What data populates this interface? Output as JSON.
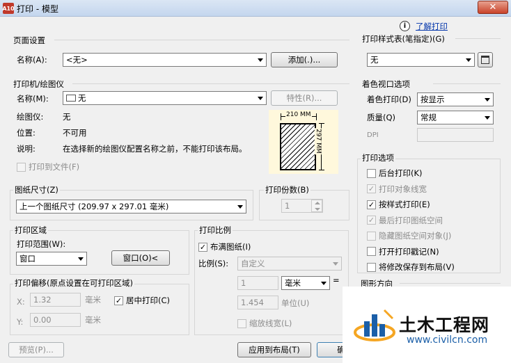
{
  "window": {
    "app_icon": "A10",
    "title": "打印 - 模型",
    "close": "✕",
    "help_link": "了解打印",
    "info_icon": "i"
  },
  "page_setup": {
    "group": "页面设置",
    "name_label": "名称(A):",
    "name_value": "<无>",
    "add_button": "添加(.)..."
  },
  "printer": {
    "group": "打印机/绘图仪",
    "name_label": "名称(M):",
    "name_value": "无",
    "properties_button": "特性(R)...",
    "plotter_label": "绘图仪:",
    "plotter_value": "无",
    "location_label": "位置:",
    "location_value": "不可用",
    "description_label": "说明:",
    "description_value": "在选择新的绘图仪配置名称之前，不能打印该布局。",
    "print_to_file": "打印到文件(F)",
    "preview_width": "210 MM",
    "preview_height": "297 MM"
  },
  "paper_size": {
    "group": "图纸尺寸(Z)",
    "value": "上一个图纸尺寸  (209.97 x 297.01 毫米)"
  },
  "copies": {
    "group": "打印份数(B)",
    "value": "1"
  },
  "plot_area": {
    "group": "打印区域",
    "what_label": "打印范围(W):",
    "what_value": "窗口",
    "window_button": "窗口(O)<"
  },
  "plot_offset": {
    "group": "打印偏移(原点设置在可打印区域)",
    "x_label": "X:",
    "x_value": "1.32",
    "x_unit": "毫米",
    "y_label": "Y:",
    "y_value": "0.00",
    "y_unit": "毫米",
    "center": "居中打印(C)"
  },
  "plot_scale": {
    "group": "打印比例",
    "fit": "布满图纸(I)",
    "scale_label": "比例(S):",
    "scale_value": "自定义",
    "value1": "1",
    "unit1": "毫米",
    "equals": "=",
    "value2": "1.454",
    "unit2": "单位(U)",
    "lineweights": "缩放线宽(L)"
  },
  "style_table": {
    "group": "打印样式表(笔指定)(G)",
    "value": "无"
  },
  "shaded": {
    "group": "着色视口选项",
    "shade_label": "着色打印(D)",
    "shade_value": "按显示",
    "quality_label": "质量(Q)",
    "quality_value": "常规",
    "dpi_label": "DPI"
  },
  "options": {
    "group": "打印选项",
    "items": [
      {
        "label": "后台打印(K)",
        "checked": false,
        "enabled": true
      },
      {
        "label": "打印对象线宽",
        "checked": true,
        "enabled": false
      },
      {
        "label": "按样式打印(E)",
        "checked": true,
        "enabled": true
      },
      {
        "label": "最后打印图纸空间",
        "checked": true,
        "enabled": false
      },
      {
        "label": "隐藏图纸空间对象(J)",
        "checked": false,
        "enabled": false
      },
      {
        "label": "打开打印戳记(N)",
        "checked": false,
        "enabled": true
      },
      {
        "label": "将修改保存到布局(V)",
        "checked": false,
        "enabled": true
      }
    ]
  },
  "orientation": {
    "group": "图形方向"
  },
  "footer": {
    "preview_button": "预览(P)...",
    "apply_button": "应用到布局(T)",
    "ok_button": "确"
  },
  "watermark": {
    "brand": "土木工程网",
    "url": "www.civilcn.com"
  },
  "icons": {
    "check": "✓"
  }
}
